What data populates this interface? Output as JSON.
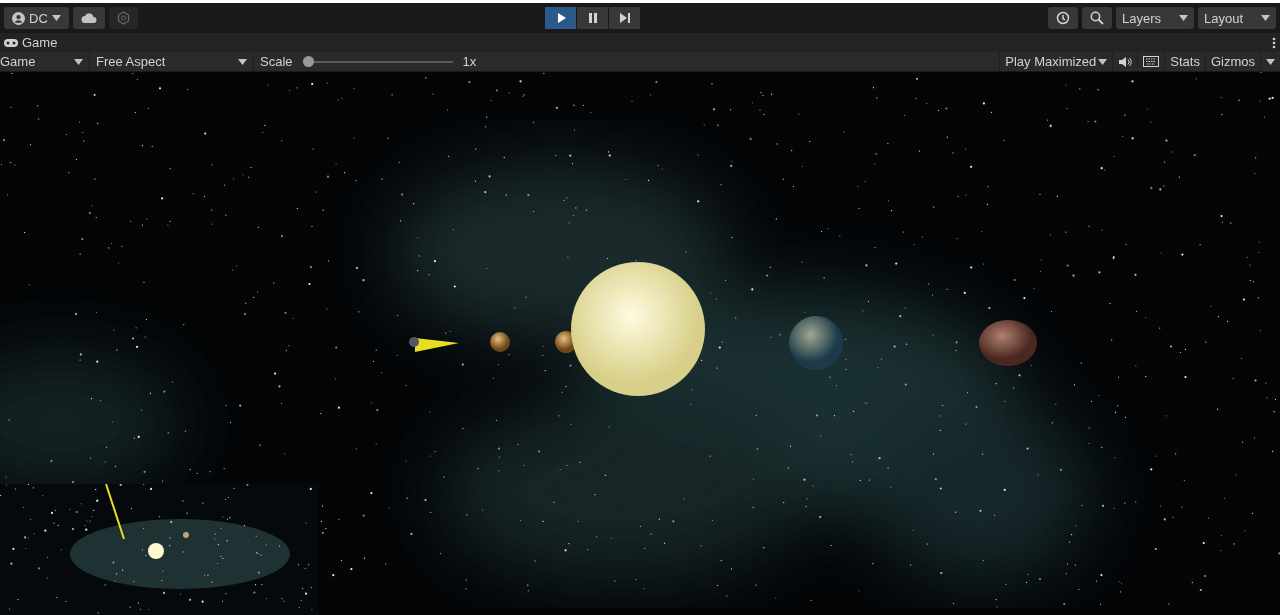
{
  "top_bar": {
    "account": {
      "label": "DC"
    },
    "play_controls": [
      {
        "kind": "play",
        "selected": true
      },
      {
        "kind": "pause",
        "selected": false
      },
      {
        "kind": "step",
        "selected": false
      }
    ],
    "layers": {
      "label": "Layers"
    },
    "layout": {
      "label": "Layout"
    }
  },
  "tab": {
    "label": "Game"
  },
  "game_toolbar": {
    "display": {
      "label": "Game"
    },
    "aspect": {
      "label": "Free Aspect"
    },
    "scale": {
      "label": "Scale",
      "level": 0,
      "reading": "1x"
    },
    "play_mode": {
      "label": "Play Maximized"
    },
    "stats": {
      "label": "Stats"
    },
    "gizmos": {
      "label": "Gizmos"
    }
  }
}
